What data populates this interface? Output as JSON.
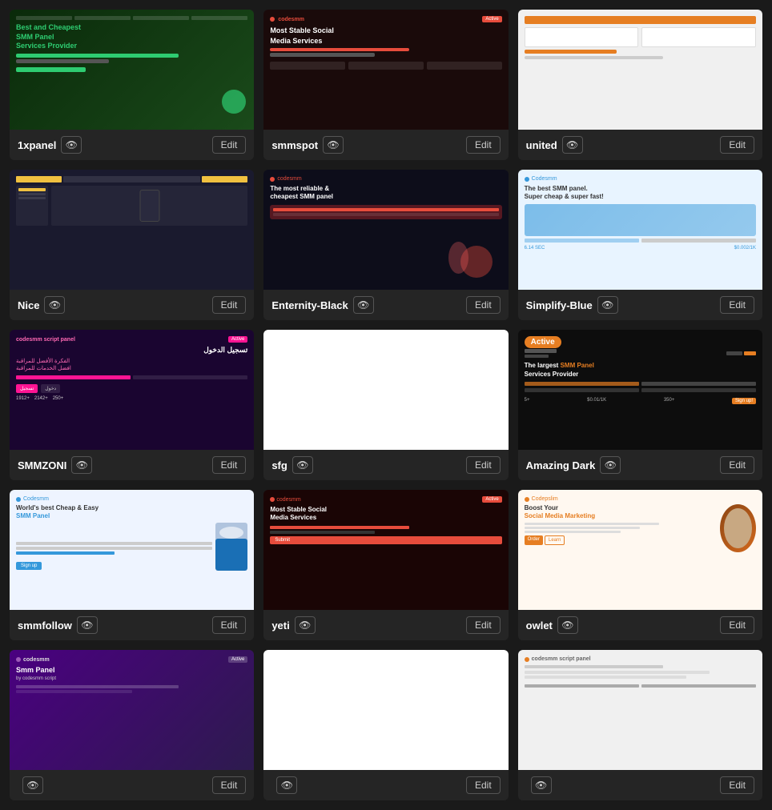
{
  "grid": {
    "cards": [
      {
        "id": "1xpanel",
        "name": "1xpanel",
        "theme": "1xpanel",
        "active": false,
        "eye_label": "👁",
        "edit_label": "Edit",
        "title_line1": "Best and Cheapest",
        "title_line2": "SMM Panel",
        "title_line3": "Services Provider",
        "color": "green"
      },
      {
        "id": "smmspot",
        "name": "smmspot",
        "theme": "smmspot",
        "active": false,
        "eye_label": "👁",
        "edit_label": "Edit",
        "title_line1": "Most Stable Social",
        "title_line2": "Media Services",
        "color": "red"
      },
      {
        "id": "united",
        "name": "united",
        "theme": "united",
        "active": false,
        "eye_label": "👁",
        "edit_label": "Edit",
        "color": "light"
      },
      {
        "id": "nice",
        "name": "Nice",
        "theme": "nice",
        "active": false,
        "eye_label": "👁",
        "edit_label": "Edit",
        "color": "dark"
      },
      {
        "id": "enternity-black",
        "name": "Enternity-Black",
        "theme": "enternity",
        "active": false,
        "eye_label": "👁",
        "edit_label": "Edit",
        "title_line1": "The most reliable & cheapest SMM panel",
        "color": "black"
      },
      {
        "id": "simplify-blue",
        "name": "Simplify-Blue",
        "theme": "simplify",
        "active": false,
        "eye_label": "👁",
        "edit_label": "Edit",
        "title_line1": "The best SMM panel. Super cheap & super fast!",
        "color": "blue"
      },
      {
        "id": "smmzoni",
        "name": "SMMZONI",
        "theme": "smmzoni",
        "active": false,
        "eye_label": "👁",
        "edit_label": "Edit",
        "color": "dark-pink"
      },
      {
        "id": "sfg",
        "name": "sfg",
        "theme": "sfg",
        "active": false,
        "eye_label": "👁",
        "edit_label": "Edit",
        "color": "white"
      },
      {
        "id": "amazing-dark",
        "name": "Amazing Dark",
        "theme": "amazing",
        "active": true,
        "active_label": "Active",
        "eye_label": "👁",
        "edit_label": "Edit",
        "title_line1": "The largest SMM Panel Services Provider",
        "color": "dark"
      },
      {
        "id": "smmfollow",
        "name": "smmfollow",
        "theme": "smmfollow",
        "active": false,
        "eye_label": "👁",
        "edit_label": "Edit",
        "title_line1": "World's best Cheap & Easy",
        "title_line2": "SMM Panel",
        "color": "light-blue"
      },
      {
        "id": "yeti",
        "name": "yeti",
        "theme": "yeti",
        "active": false,
        "eye_label": "👁",
        "edit_label": "Edit",
        "title_line1": "Most Stable Social Media Services",
        "color": "dark-red"
      },
      {
        "id": "owlet",
        "name": "owlet",
        "theme": "owlet",
        "active": false,
        "eye_label": "👁",
        "edit_label": "Edit",
        "title_line1": "Boost Your Social Media Marketing",
        "color": "light-orange"
      },
      {
        "id": "p13",
        "name": "",
        "theme": "p13",
        "active": false,
        "eye_label": "👁",
        "edit_label": "Edit",
        "title_line1": "Smm Panel",
        "color": "purple"
      },
      {
        "id": "p14",
        "name": "",
        "theme": "p14",
        "active": false,
        "eye_label": "👁",
        "edit_label": "Edit",
        "color": "white"
      },
      {
        "id": "p15",
        "name": "",
        "theme": "p15",
        "active": false,
        "eye_label": "👁",
        "edit_label": "Edit",
        "color": "light-gray"
      }
    ]
  }
}
